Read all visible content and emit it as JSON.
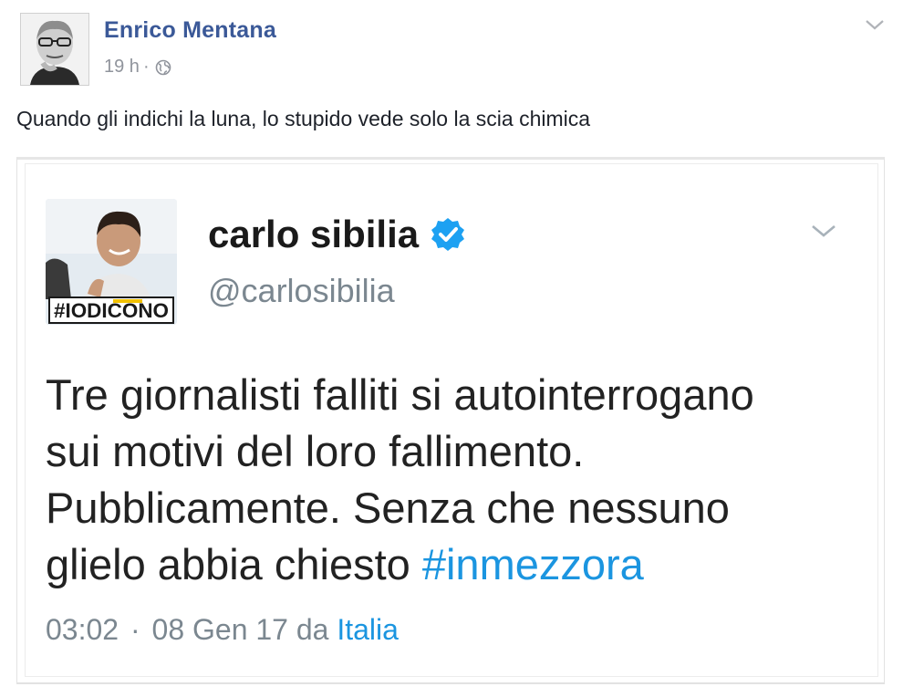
{
  "post": {
    "author": "Enrico Mentana",
    "time": "19 h",
    "separator": "·",
    "audience_icon": "globe-icon",
    "options_icon": "chevron-down-icon",
    "text": "Quando gli indichi la luna, lo stupido vede solo la scia chimica"
  },
  "tweet": {
    "name": "carlo sibilia",
    "verified_icon": "verified-badge-icon",
    "handle": "@carlosibilia",
    "avatar_badge": "#IODICONO",
    "options_icon": "chevron-down-icon",
    "text_lines": [
      "Tre giornalisti falliti si autointerrogano",
      "sui motivi del loro fallimento.",
      "Pubblicamente. Senza che nessuno",
      "glielo abbia chiesto"
    ],
    "hashtag": "#inmezzora",
    "time": "03:02",
    "separator": "·",
    "date": "08 Gen 17",
    "from_label": "da",
    "location": "Italia"
  },
  "colors": {
    "facebook_blue": "#3b5998",
    "twitter_blue": "#1b95e0",
    "meta_gray": "#90949c"
  }
}
